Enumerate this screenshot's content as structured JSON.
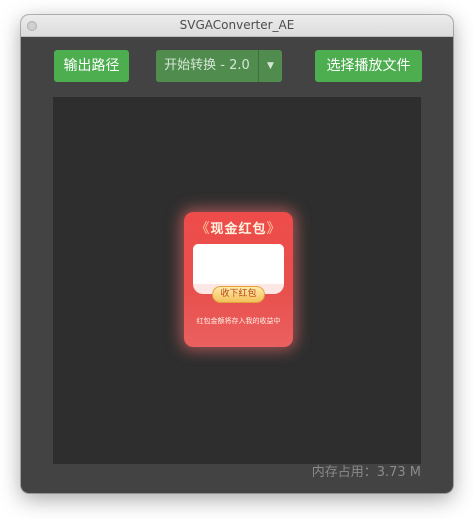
{
  "window": {
    "title": "SVGAConverter_AE"
  },
  "toolbar": {
    "output_path_label": "输出路径",
    "convert_label": "开始转换 - 2.0",
    "choose_file_label": "选择播放文件"
  },
  "preview": {
    "envelope_title": "现金红包",
    "quote_left": "《",
    "quote_right": "》",
    "receive_label": "收下红包",
    "note": "红包金额将存入我的收益中"
  },
  "status": {
    "memory": "内存占用：3.73 M"
  },
  "icons": {
    "caret": "chevron-down-icon"
  },
  "colors": {
    "window_bg": "#434343",
    "canvas_bg": "#2e2e2e",
    "button_green": "#4cae4f",
    "button_disabled_green": "#4f8c4e",
    "envelope_red": "#ee4c4a"
  }
}
